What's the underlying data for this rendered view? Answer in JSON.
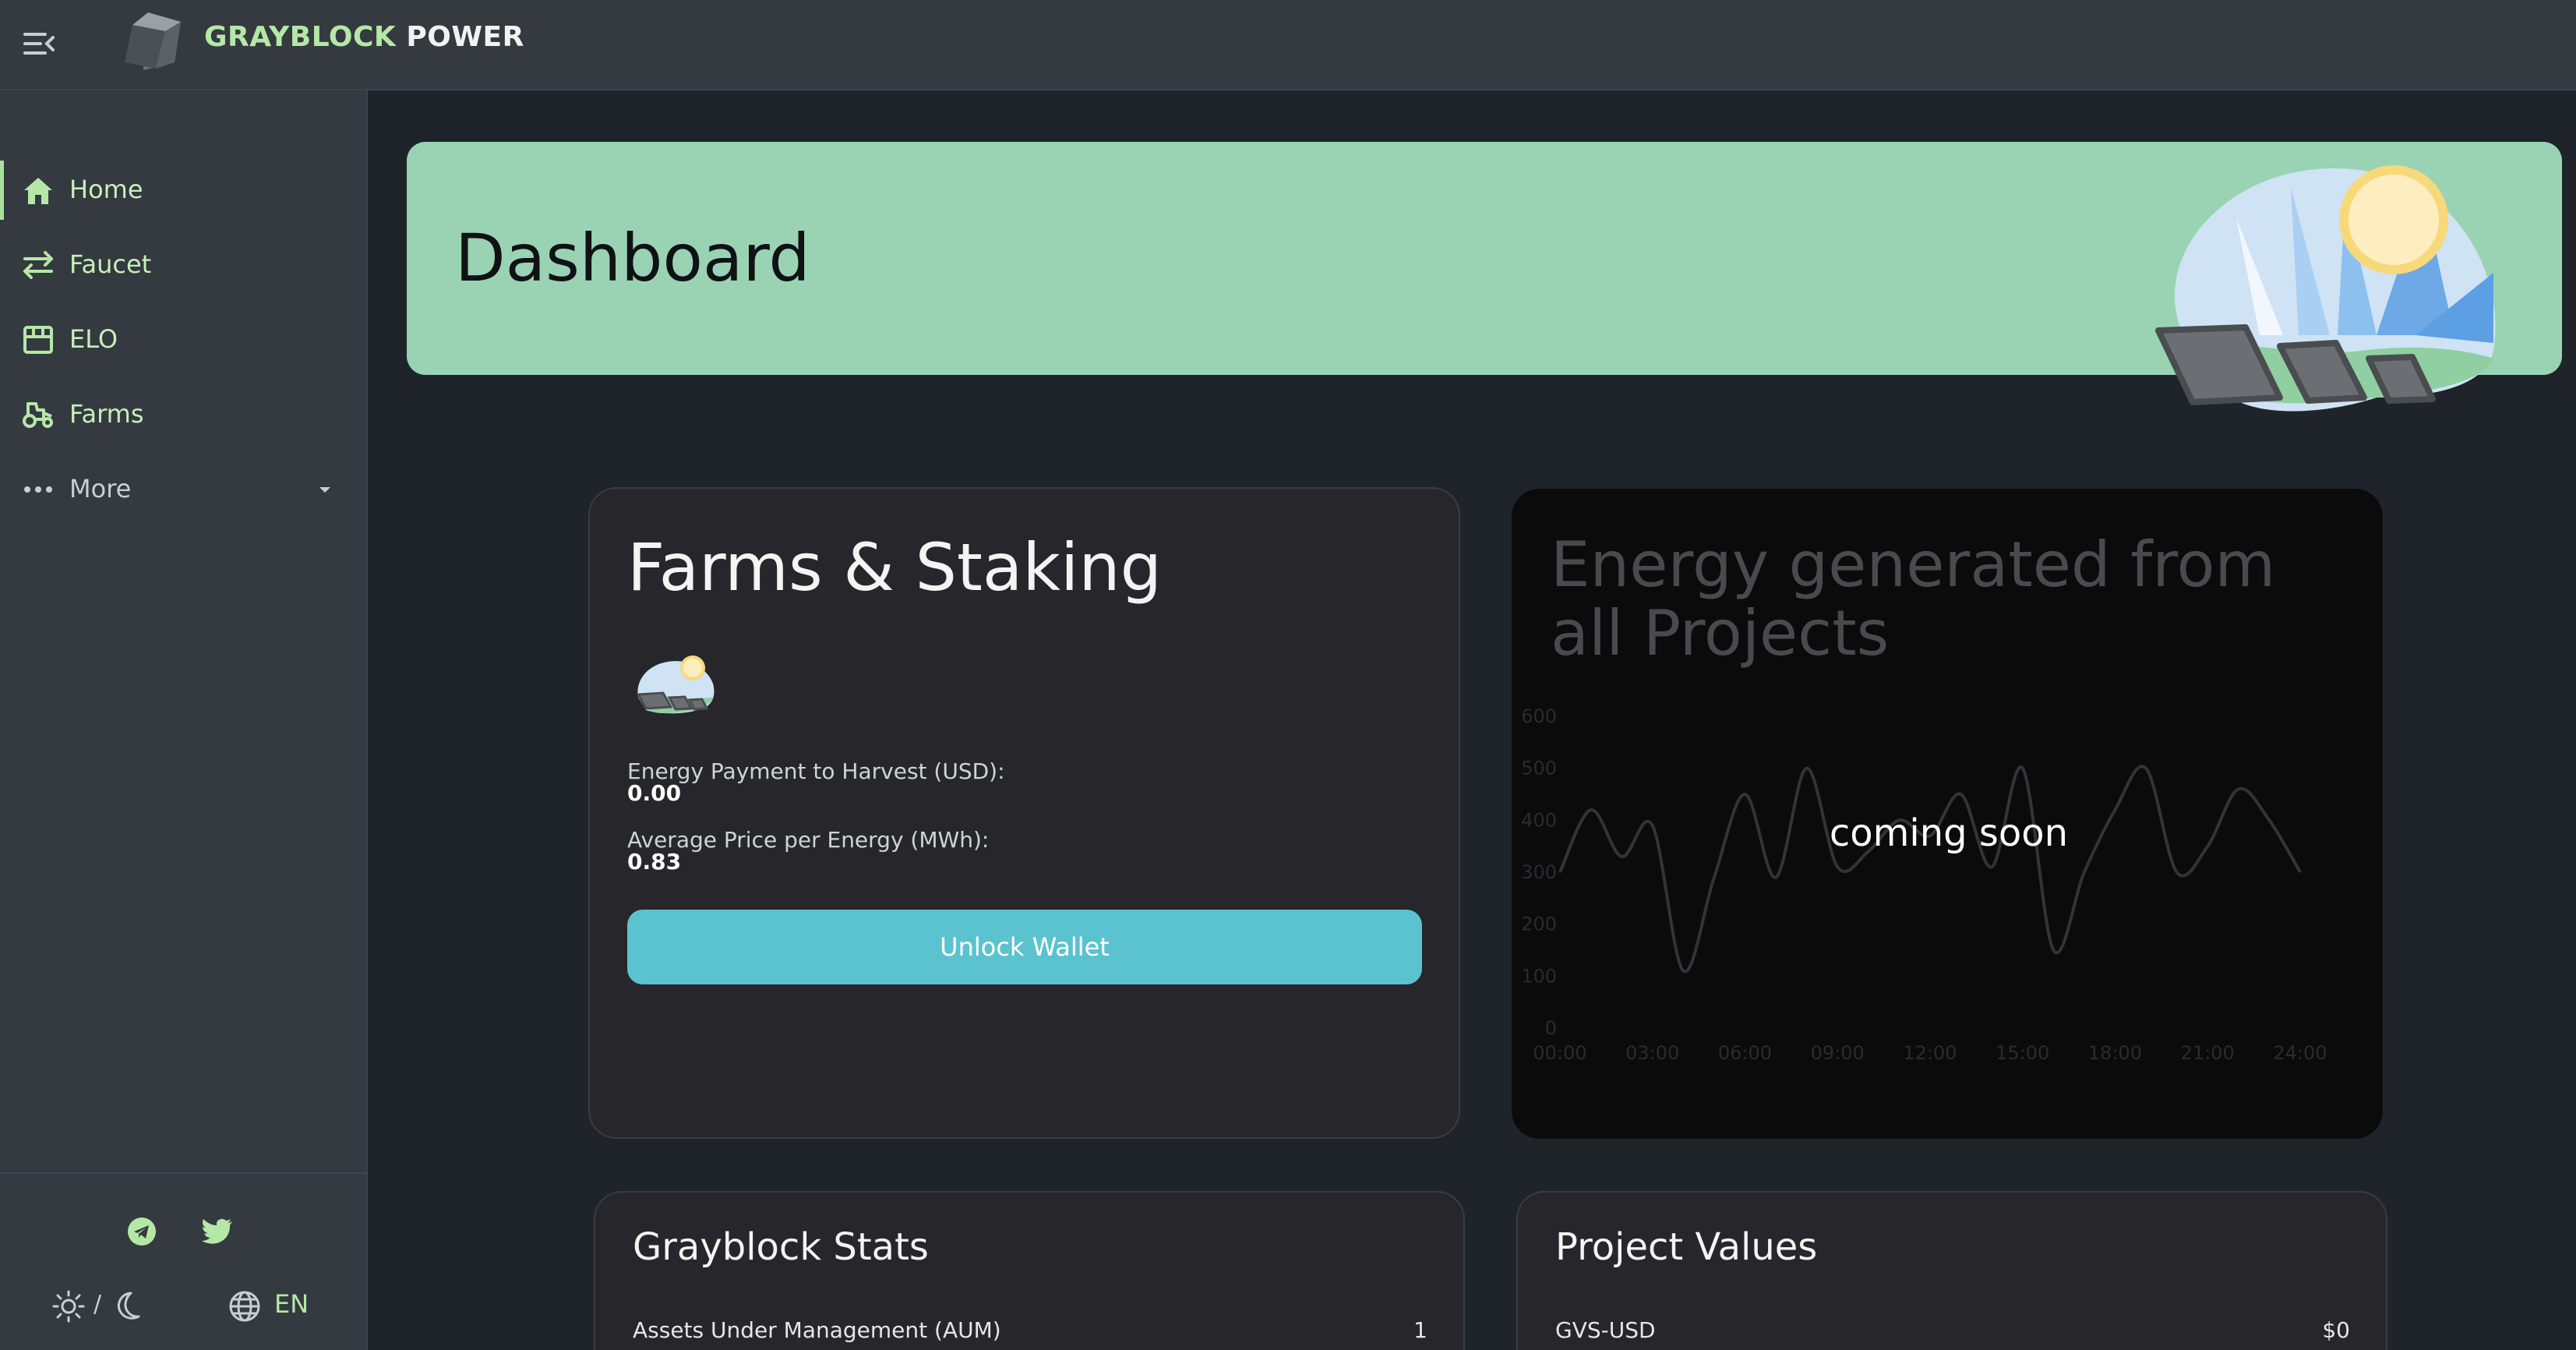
{
  "header": {
    "brand_part1": "GRAYBLOCK",
    "brand_part2": "POWER",
    "brand_color": "#b5e8a6"
  },
  "sidebar": {
    "items": [
      {
        "label": "Home",
        "icon": "home-icon",
        "active": true
      },
      {
        "label": "Faucet",
        "icon": "swap-arrows-icon"
      },
      {
        "label": "ELO",
        "icon": "storefront-icon"
      },
      {
        "label": "Farms",
        "icon": "tractor-icon"
      },
      {
        "label": "More",
        "icon": "more-dots-icon"
      }
    ],
    "footer": {
      "social_icons": [
        "telegram-icon",
        "twitter-icon"
      ],
      "theme_icons": [
        "sun-icon",
        "moon-icon"
      ],
      "theme_separator": "/",
      "language": "EN"
    }
  },
  "hero": {
    "title": "Dashboard",
    "background": "#9ad3b3"
  },
  "farms_card": {
    "title": "Farms & Staking",
    "payment_label": "Energy Payment to Harvest (USD):",
    "payment_value": "0.00",
    "price_label": "Average Price per Energy (MWh):",
    "price_value": "0.83",
    "unlock_button": "Unlock Wallet",
    "button_color": "#5bc3cf"
  },
  "energy_card": {
    "title": "Energy generated from all Projects",
    "overlay_text": "coming soon"
  },
  "chart_data": {
    "type": "line",
    "title": "Energy generated from all Projects",
    "x_tick_labels": [
      "00:00",
      "03:00",
      "06:00",
      "09:00",
      "12:00",
      "15:00",
      "18:00",
      "21:00",
      "24:00"
    ],
    "y_tick_labels": [
      "0",
      "100",
      "200",
      "300",
      "400",
      "500",
      "600"
    ],
    "x": [
      0,
      1,
      2,
      3,
      4,
      5,
      6,
      7,
      8,
      9,
      10,
      11,
      12,
      13,
      14,
      15,
      16,
      17,
      18,
      19,
      20,
      21,
      22,
      23,
      24
    ],
    "values": [
      300,
      420,
      330,
      390,
      110,
      290,
      450,
      290,
      500,
      310,
      340,
      400,
      370,
      450,
      310,
      500,
      150,
      300,
      420,
      500,
      300,
      350,
      460,
      400,
      300
    ],
    "ylim": [
      0,
      600
    ],
    "xlim": [
      0,
      24
    ],
    "grid": false
  },
  "stats_card": {
    "title": "Grayblock Stats",
    "rows": [
      {
        "label": "Assets Under Management (AUM)",
        "value": "1"
      }
    ]
  },
  "values_card": {
    "title": "Project Values",
    "rows": [
      {
        "label": "GVS-USD",
        "value": "$0"
      }
    ]
  }
}
